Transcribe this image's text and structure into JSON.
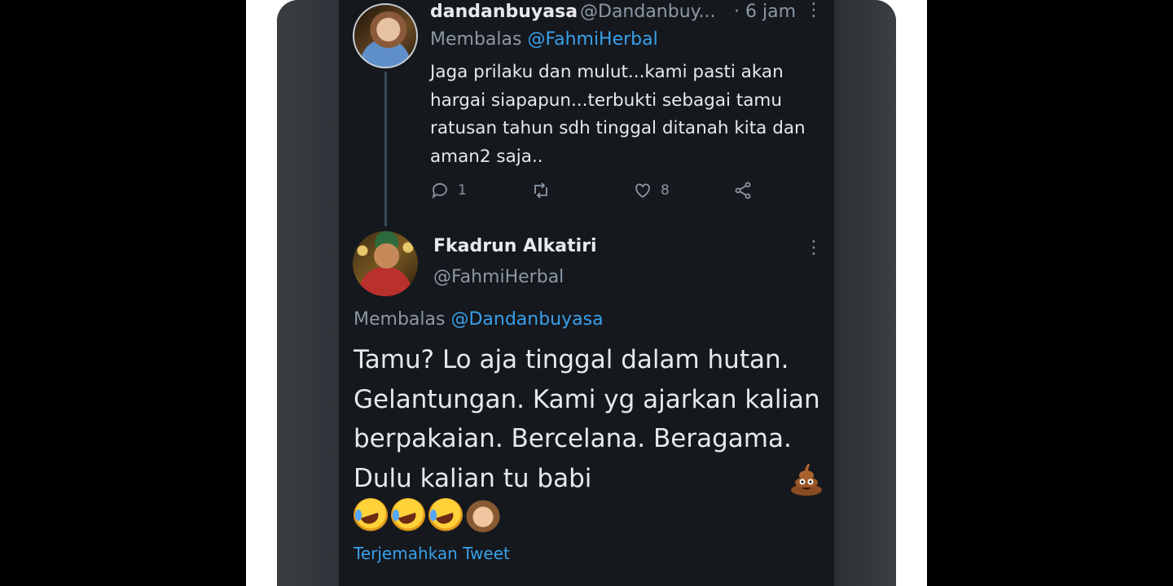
{
  "tweet1": {
    "name": "dandanbuyasa",
    "handle": "@Dandanbuy...",
    "time": "· 6 jam",
    "reply_prefix": "Membalas ",
    "reply_to": "@FahmiHerbal",
    "text": "Jaga prilaku dan mulut...kami pasti akan hargai siapapun...terbukti sebagai tamu ratusan tahun sdh tinggal ditanah kita dan aman2 saja..",
    "reply_count": "1",
    "retweet_count": "",
    "like_count": "8",
    "icons": [
      "reply-icon",
      "retweet-icon",
      "like-icon",
      "share-icon",
      "more-icon"
    ]
  },
  "tweet2": {
    "name": "Fkadrun Alkatiri",
    "handle": "@FahmiHerbal",
    "reply_prefix": "Membalas ",
    "reply_to": "@Dandanbuyasa",
    "text": "Tamu? Lo aja tinggal dalam hutan. Gelantungan. Kami yg ajarkan kalian berpakaian. Bercelana. Beragama.  Dulu kalian tu babi",
    "emojis": [
      "pile-of-poo",
      "rolling-on-floor-laughing",
      "rolling-on-floor-laughing",
      "rolling-on-floor-laughing",
      "see-no-evil-monkey"
    ],
    "translate_label": "Terjemahkan Tweet"
  },
  "more_glyph": "⋮",
  "colors": {
    "background": "#15181d",
    "text": "#e7e9ea",
    "muted": "#8b98a5",
    "link": "#3aa0ea"
  }
}
